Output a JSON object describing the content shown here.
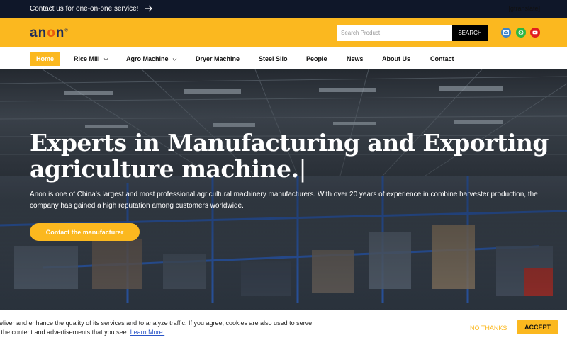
{
  "topbar": {
    "promo": "Contact us for one-on-one service!",
    "translate": "[gtranslate]"
  },
  "header": {
    "logo": {
      "a": "an",
      "o": "o",
      "n": "n",
      "mark": "®"
    },
    "search_placeholder": "Search Product",
    "search_button": "SEARCH",
    "social_icons": [
      "mail-icon",
      "whatsapp-icon",
      "youtube-icon"
    ]
  },
  "nav": {
    "items": [
      {
        "label": "Home",
        "active": true
      },
      {
        "label": "Rice Mill",
        "dropdown": true
      },
      {
        "label": "Agro Machine",
        "dropdown": true
      },
      {
        "label": "Dryer Machine"
      },
      {
        "label": "Steel Silo"
      },
      {
        "label": "People"
      },
      {
        "label": "News"
      },
      {
        "label": "About Us"
      },
      {
        "label": "Contact"
      }
    ]
  },
  "hero": {
    "title_line1": "Experts in Manufacturing and Exporting",
    "title_line2": "agriculture machine.",
    "cursor": "|",
    "description": "Anon is one of China's largest and most professional agricultural machinery manufacturers. With over 20 years of experience in combine harvester production, the company has gained a high reputation among customers worldwide.",
    "cta": "Contact the manufacturer"
  },
  "cookie": {
    "line1": "deliver and enhance the quality of its services and to analyze traffic. If you agree, cookies are also used to serve",
    "line2": "e the content and advertisements that you see.",
    "learn_more": "Learn More.",
    "no_thanks": "NO THANKS",
    "accept": "ACCEPT"
  },
  "colors": {
    "accent": "#fbb81f",
    "topbar": "#0f1729",
    "logo_blue": "#1e2b5a",
    "logo_orange": "#e85c0d"
  }
}
